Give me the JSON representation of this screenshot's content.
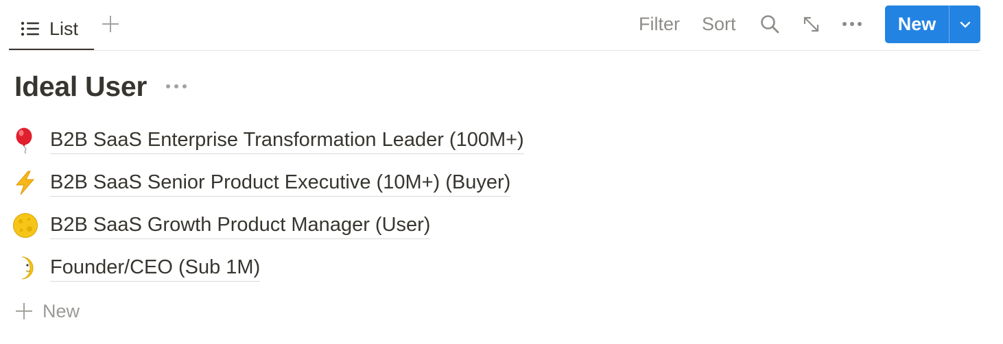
{
  "toolbar": {
    "view_tab": {
      "label": "List",
      "icon": "list-icon"
    },
    "add_view_icon": "plus-icon",
    "filter_label": "Filter",
    "sort_label": "Sort",
    "search_icon": "search-icon",
    "expand_icon": "expand-icon",
    "more_icon": "more-horizontal-icon",
    "new_button": {
      "label": "New",
      "dropdown_icon": "chevron-down-icon",
      "color": "#2383e2"
    }
  },
  "database": {
    "title": "Ideal User",
    "more_icon": "more-horizontal-icon"
  },
  "items": [
    {
      "icon": "balloon-emoji",
      "title": "B2B SaaS Enterprise Transformation Leader (100M+)"
    },
    {
      "icon": "lightning-emoji",
      "title": "B2B SaaS Senior Product Executive (10M+) (Buyer)"
    },
    {
      "icon": "full-moon-emoji",
      "title": "B2B SaaS Growth Product Manager (User)"
    },
    {
      "icon": "crescent-moon-emoji",
      "title": "Founder/CEO (Sub 1M)"
    }
  ],
  "add_row": {
    "label": "New",
    "icon": "plus-icon"
  }
}
